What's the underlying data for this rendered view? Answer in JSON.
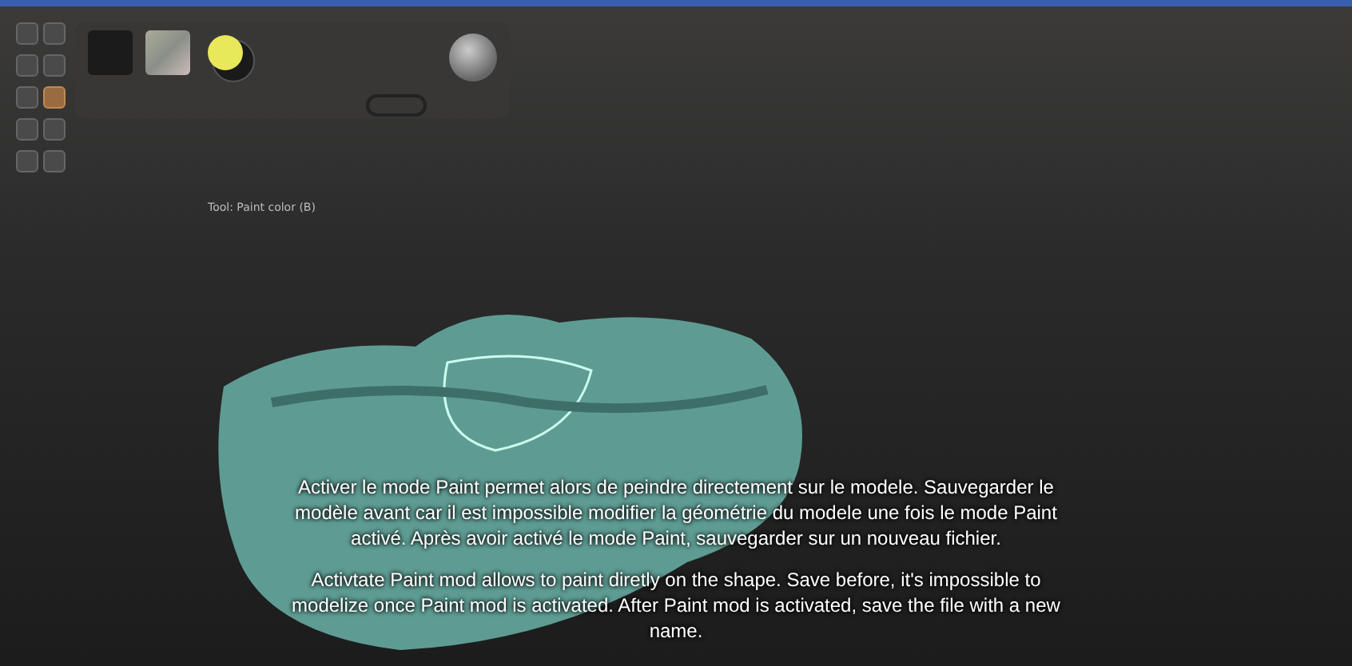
{
  "tool_buttons": [
    {
      "selected": false
    },
    {
      "selected": false
    },
    {
      "selected": false
    },
    {
      "selected": false
    },
    {
      "selected": false
    },
    {
      "selected": true
    },
    {
      "selected": false
    },
    {
      "selected": false
    },
    {
      "selected": false
    },
    {
      "selected": false
    }
  ],
  "status_text": "Tool: Paint color (B)",
  "subtitles": [
    "Activer le mode Paint permet alors de peindre directement sur le modele. Sauvegarder le modèle avant car il est impossible modifier la géométrie du modele une fois le mode Paint activé. Après avoir activé le mode Paint, sauvegarder sur un nouveau fichier.",
    "Activtate Paint mod allows to paint diretly on the shape. Save before, it's impossible to modelize once Paint mod is activated. After Paint mod is activated, save the file with a new name."
  ]
}
